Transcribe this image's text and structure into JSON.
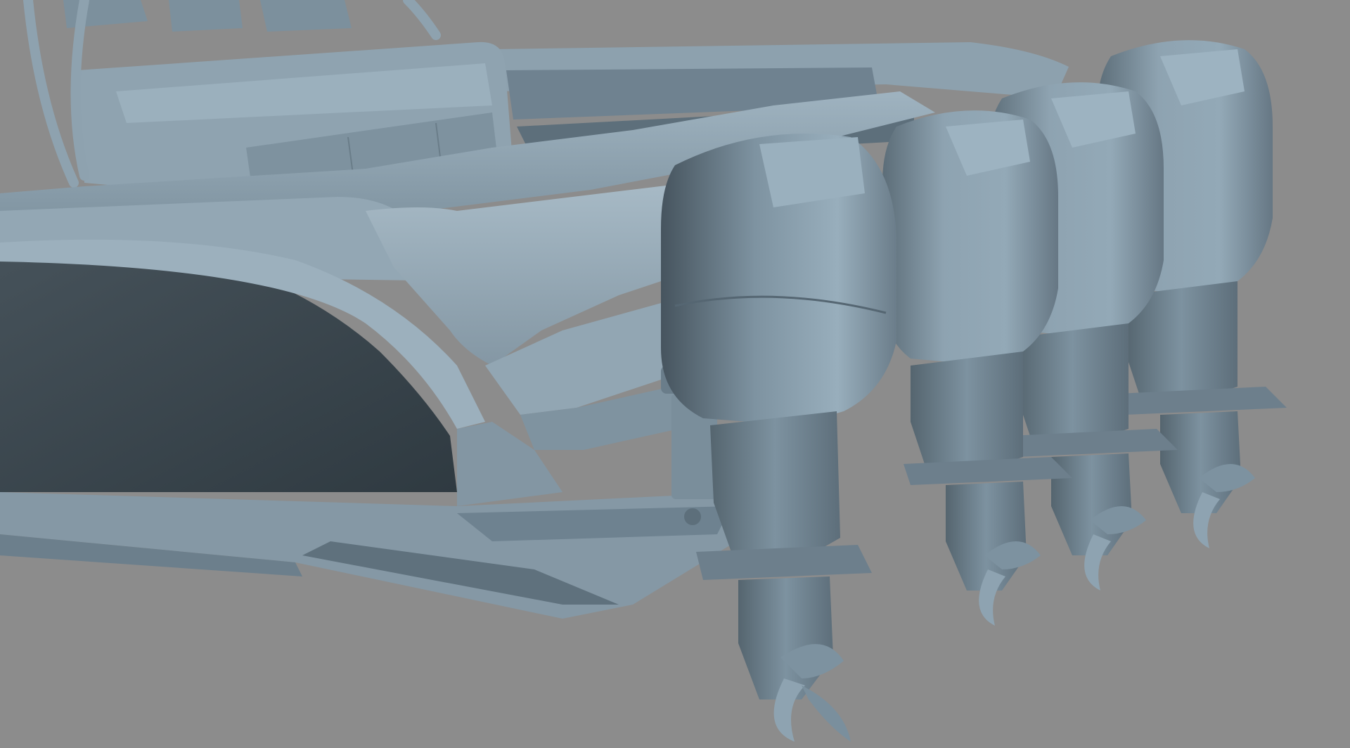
{
  "scene": {
    "subject": "boat-stern-with-quad-outboard-motors",
    "background_color": "#8c8c8c",
    "model_color": "#7f95a3",
    "hull_side_color": "#3b464e",
    "motor_count": 4
  }
}
